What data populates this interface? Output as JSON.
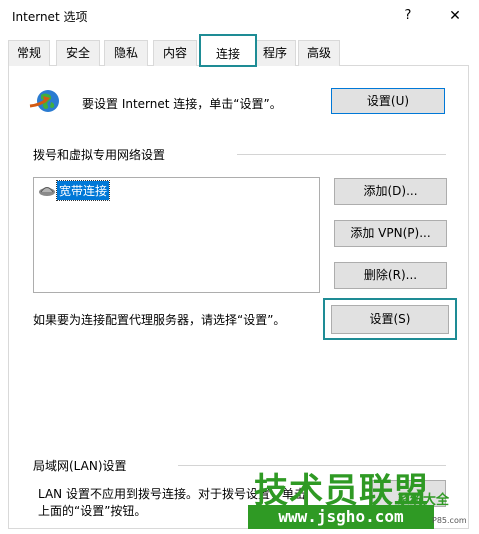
{
  "window": {
    "title": "Internet 选项",
    "help_glyph": "?",
    "close_glyph": "✕"
  },
  "tabs": [
    {
      "label": "常规"
    },
    {
      "label": "安全"
    },
    {
      "label": "隐私"
    },
    {
      "label": "内容"
    },
    {
      "label": "连接",
      "active": true
    },
    {
      "label": "程序"
    },
    {
      "label": "高级"
    }
  ],
  "setup": {
    "text": "要设置 Internet 连接，单击“设置”。",
    "button": "设置(U)"
  },
  "dialup": {
    "group_label": "拨号和虚拟专用网络设置",
    "connections": [
      "宽带连接"
    ],
    "add_button": "添加(D)...",
    "add_vpn_button": "添加 VPN(P)...",
    "remove_button": "删除(R)...",
    "proxy_text": "如果要为连接配置代理服务器，请选择“设置”。",
    "settings_button": "设置(S)"
  },
  "lan": {
    "group_label": "局域网(LAN)设置",
    "text_line1": "LAN 设置不应用到拨号连接。对于拨号设置，单击",
    "text_line2": "上面的“设置”按钮。"
  },
  "watermark": {
    "brand": "技术员联盟",
    "url": "www.jsgho.com",
    "tag": "系统大全",
    "small": "P85.com"
  },
  "colors": {
    "highlight_border": "#1e8c95",
    "selection": "#0078d7",
    "watermark_green": "#2f9a24"
  }
}
